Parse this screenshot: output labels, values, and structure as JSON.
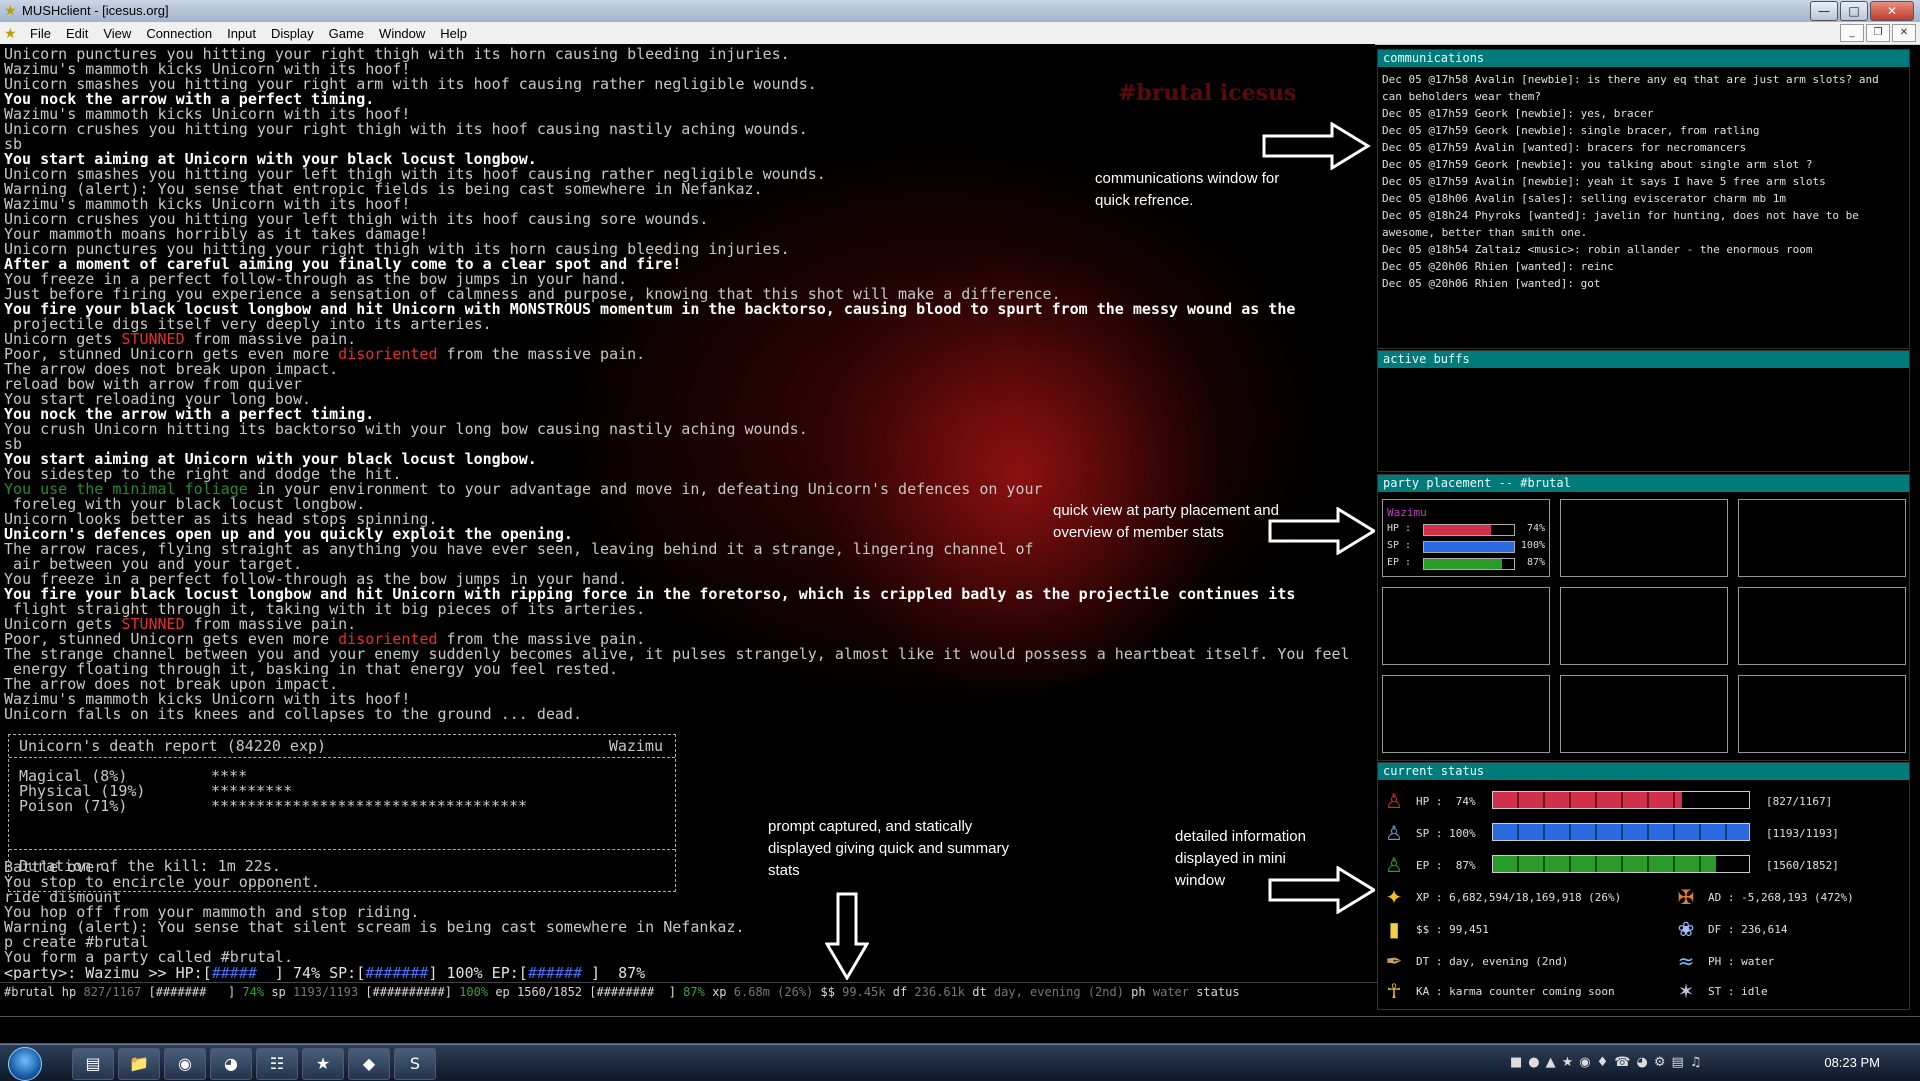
{
  "window": {
    "title": "MUSHclient - [icesus.org]"
  },
  "menu": [
    "File",
    "Edit",
    "View",
    "Connection",
    "Input",
    "Display",
    "Game",
    "Window",
    "Help"
  ],
  "output": {
    "watermark": "#brutal icesus",
    "lines": [
      "Unicorn punctures you hitting your right thigh with its horn causing bleeding injuries.",
      "Wazimu's mammoth kicks Unicorn with its hoof!",
      "Unicorn smashes you hitting your right arm with its hoof causing rather negligible wounds.",
      "You nock the arrow with a perfect timing.",
      "Wazimu's mammoth kicks Unicorn with its hoof!",
      "Unicorn crushes you hitting your right thigh with its hoof causing nastily aching wounds.",
      "sb",
      "You start aiming at Unicorn with your black locust longbow.",
      "Unicorn smashes you hitting your left thigh with its hoof causing rather negligible wounds.",
      "Warning (alert): You sense that entropic fields is being cast somewhere in Nefankaz.",
      "Wazimu's mammoth kicks Unicorn with its hoof!",
      "Unicorn crushes you hitting your left thigh with its hoof causing sore wounds.",
      "Your mammoth moans horribly as it takes damage!",
      "Unicorn punctures you hitting your right thigh with its horn causing bleeding injuries.",
      "After a moment of careful aiming you finally come to a clear spot and fire!",
      "You freeze in a perfect follow-through as the bow jumps in your hand.",
      "Just before firing you experience a sensation of calmness and purpose, knowing that this shot will make a difference.",
      "You fire your black locust longbow and hit Unicorn with MONSTROUS momentum in the backtorso, causing blood to spurt from the messy wound as the",
      " projectile digs itself very deeply into its arteries.",
      "Unicorn gets STUNNED from massive pain.",
      "Poor, stunned Unicorn gets even more disoriented from the massive pain.",
      "The arrow does not break upon impact.",
      "reload bow with arrow from quiver",
      "You start reloading your long bow.",
      "You nock the arrow with a perfect timing.",
      "You crush Unicorn hitting its backtorso with your long bow causing nastily aching wounds.",
      "sb",
      "You start aiming at Unicorn with your black locust longbow.",
      "You sidestep to the right and dodge the hit.",
      "You use the minimal foliage in your environment to your advantage and move in, defeating Unicorn's defences on your",
      " foreleg with your black locust longbow.",
      "Unicorn looks better as its head stops spinning.",
      "Unicorn's defences open up and you quickly exploit the opening.",
      "The arrow races, flying straight as anything you have ever seen, leaving behind it a strange, lingering channel of",
      " air between you and your target.",
      "You freeze in a perfect follow-through as the bow jumps in your hand.",
      "You fire your black locust longbow and hit Unicorn with ripping force in the foretorso, which is crippled badly as the projectile continues its",
      " flight straight through it, taking with it big pieces of its arteries.",
      "Unicorn gets STUNNED from massive pain.",
      "Poor, stunned Unicorn gets even more disoriented from the massive pain.",
      "The strange channel between you and your enemy suddenly becomes alive, it pulses strangely, almost like it would possess a heartbeat itself. You feel",
      " energy floating through it, basking in that energy you feel rested.",
      "The arrow does not break upon impact.",
      "Wazimu's mammoth kicks Unicorn with its hoof!",
      "Unicorn falls on its knees and collapses to the ground ... dead."
    ],
    "after_report": [
      "Battle over.",
      "You stop to encircle your opponent.",
      "ride dismount",
      "You hop off from your mammoth and stop riding.",
      "Warning (alert): You sense that silent scream is being cast somewhere in Nefankaz.",
      "p create #brutal",
      "You form a party called #brutal."
    ],
    "prompt": {
      "prefix": "<party>: Wazimu >> HP:[",
      "hp_bar": "#####",
      "hp_rest": "  ] 74% SP:[",
      "sp_bar": "#######",
      "sp_rest": "] 100% EP:[",
      "ep_bar": "######",
      "ep_rest": " ]  87%"
    }
  },
  "report": {
    "title": "Unicorn's death report (84220 exp)",
    "killer": "Wazimu",
    "rows": [
      {
        "label": "Magical (8%)",
        "stars": "****"
      },
      {
        "label": "Physical (19%)",
        "stars": "*********"
      },
      {
        "label": "Poison (71%)",
        "stars": "***********************************"
      }
    ],
    "duration": "Duration of the kill: 1m 22s."
  },
  "notes": {
    "comm": "communications window for quick refrence.",
    "party": "quick view at party placement and overview of member stats",
    "prompt": "prompt captured, and statically displayed giving quick and summary stats",
    "detail": "detailed information displayed in mini window"
  },
  "statusbar": {
    "tag": "#brutal",
    "hp_lbl": " hp ",
    "hp_val": "827/1167",
    "hp_bar": " [#######   ]",
    "hp_pct": " 74%",
    "sp_lbl": " sp ",
    "sp_val": "1193/1193",
    "sp_bar": " [##########]",
    "sp_pct": " 100%",
    "ep_lbl": " ep ",
    "ep_val": "1560/1852",
    "ep_bar": " [########  ]",
    "ep_pct": " 87%",
    "xp_lbl": " xp ",
    "xp_val": "6.68m (26%)",
    "ss_lbl": " $$ ",
    "ss_val": "99.45k",
    "df_lbl": " df ",
    "df_val": "236.61k",
    "dt_lbl": " dt ",
    "dt_val": "day, evening (2nd)",
    "ph_lbl": " ph ",
    "ph_val": "water",
    "st_lbl": " status"
  },
  "communications": {
    "title": "communications",
    "messages": [
      "Dec 05 @17h58 Avalin [newbie]: is there any eq that are just arm slots? and can beholders wear them?",
      "Dec 05 @17h59 Geork [newbie]: yes, bracer",
      "Dec 05 @17h59 Geork [newbie]: single bracer, from ratling",
      "Dec 05 @17h59 Avalin [wanted]: bracers for necromancers",
      "Dec 05 @17h59 Geork [newbie]: you talking about single arm slot ?",
      "Dec 05 @17h59 Avalin [newbie]: yeah it says I have 5 free arm slots",
      "Dec 05 @18h06 Avalin [sales]: selling eviscerator charm mb 1m",
      "Dec 05 @18h24 Phyroks [wanted]: javelin for hunting, does not have to be awesome, better than smith one.",
      "Dec 05 @18h54 Zaltaiz <music>: robin allander - the enormous room",
      "Dec 05 @20h06 Rhien [wanted]: reinc",
      "Dec 05 @20h06 Rhien [wanted]: got"
    ]
  },
  "buffs": {
    "title": "active buffs"
  },
  "party": {
    "title": "party placement -- #brutal",
    "member": {
      "name": "Wazimu",
      "hp": 74,
      "sp": 100,
      "ep": 87,
      "hp_lbl": "HP :",
      "sp_lbl": "SP :",
      "ep_lbl": "EP :",
      "hp_txt": "74%",
      "sp_txt": "100%",
      "ep_txt": "87%"
    }
  },
  "status": {
    "title": "current status",
    "hp": {
      "label": "HP :  74%",
      "fill": 0.74,
      "abs": "[827/1167]"
    },
    "sp": {
      "label": "SP : 100%",
      "fill": 1.0,
      "abs": "[1193/1193]"
    },
    "ep": {
      "label": "EP :  87%",
      "fill": 0.87,
      "abs": "[1560/1852]"
    },
    "xp": "XP : 6,682,594/18,169,918 (26%)",
    "ad": "AD : -5,268,193 (472%)",
    "ss": "$$ : 99,451",
    "df": "DF : 236,614",
    "dt": "DT : day, evening (2nd)",
    "ph": "PH : water",
    "ka": "KA : karma counter coming soon",
    "st": "ST : idle"
  },
  "taskbar": {
    "clock": "08:23 PM"
  },
  "colors": {
    "hp": "#d0304a",
    "sp": "#2a6ae0",
    "ep": "#2a9a2a",
    "header": "#007a7a"
  }
}
